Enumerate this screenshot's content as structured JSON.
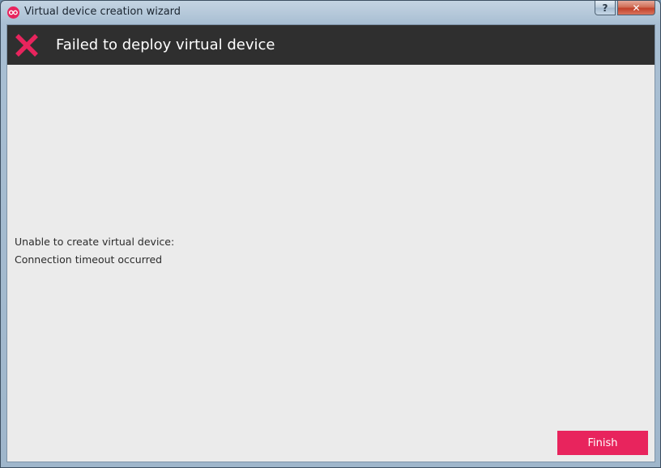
{
  "window": {
    "title": "Virtual device creation wizard",
    "app_icon": "app-logo-icon",
    "help_label": "?",
    "close_label": "✕"
  },
  "header": {
    "title": "Failed to deploy virtual device",
    "status_icon": "error-x-icon",
    "background": "#2f2f2f",
    "accent": "#e8245d"
  },
  "content": {
    "message_line1": "Unable to create virtual device:",
    "message_line2": "Connection timeout occurred"
  },
  "footer": {
    "finish_label": "Finish"
  }
}
